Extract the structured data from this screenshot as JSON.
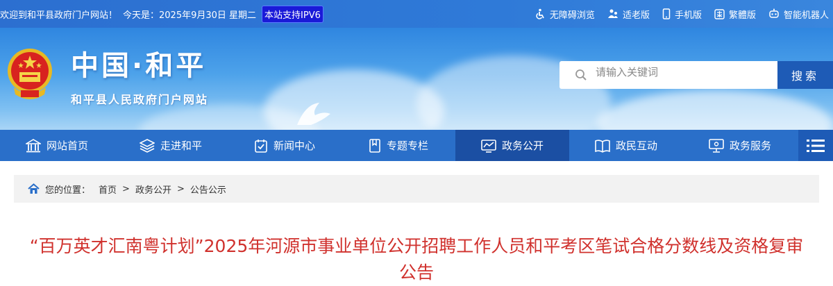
{
  "topbar": {
    "welcome": "欢迎到和平县政府门户网站！",
    "today": "今天是：2025年9月30日 星期二",
    "ipv6": "本站支持IPV6",
    "tools": [
      {
        "label": "无障碍浏览",
        "icon": "accessibility-icon"
      },
      {
        "label": "适老版",
        "icon": "elderly-icon"
      },
      {
        "label": "手机版",
        "icon": "mobile-icon"
      },
      {
        "label": "繁體版",
        "icon": "traditional-chinese-icon"
      },
      {
        "label": "智能机器人",
        "icon": "robot-icon"
      }
    ]
  },
  "banner": {
    "title": "中国·和平",
    "subtitle": "和平县人民政府门户网站"
  },
  "search": {
    "placeholder": "请输入关键词",
    "button": "搜索"
  },
  "nav": {
    "items": [
      {
        "label": "网站首页",
        "icon": "home-icon"
      },
      {
        "label": "走进和平",
        "icon": "layers-icon"
      },
      {
        "label": "新闻中心",
        "icon": "news-icon"
      },
      {
        "label": "专题专栏",
        "icon": "bookmark-icon"
      },
      {
        "label": "政务公开",
        "icon": "chart-icon"
      },
      {
        "label": "政民互动",
        "icon": "book-icon"
      },
      {
        "label": "政务服务",
        "icon": "monitor-icon"
      }
    ],
    "active_index": 4
  },
  "breadcrumb": {
    "prefix": "您的位置：",
    "items": [
      "首页",
      "政务公开",
      "公告公示"
    ],
    "separator": ">"
  },
  "article": {
    "title": "“百万英才汇南粤计划”2025年河源市事业单位公开招聘工作人员和平考区笔试合格分数线及资格复审公告"
  },
  "colors": {
    "topbar": "#2f7ad8",
    "nav": "#2a6fc9",
    "nav_active": "#1b4fa3",
    "search_button": "#1e5bb6",
    "title_red": "#d0312d"
  }
}
